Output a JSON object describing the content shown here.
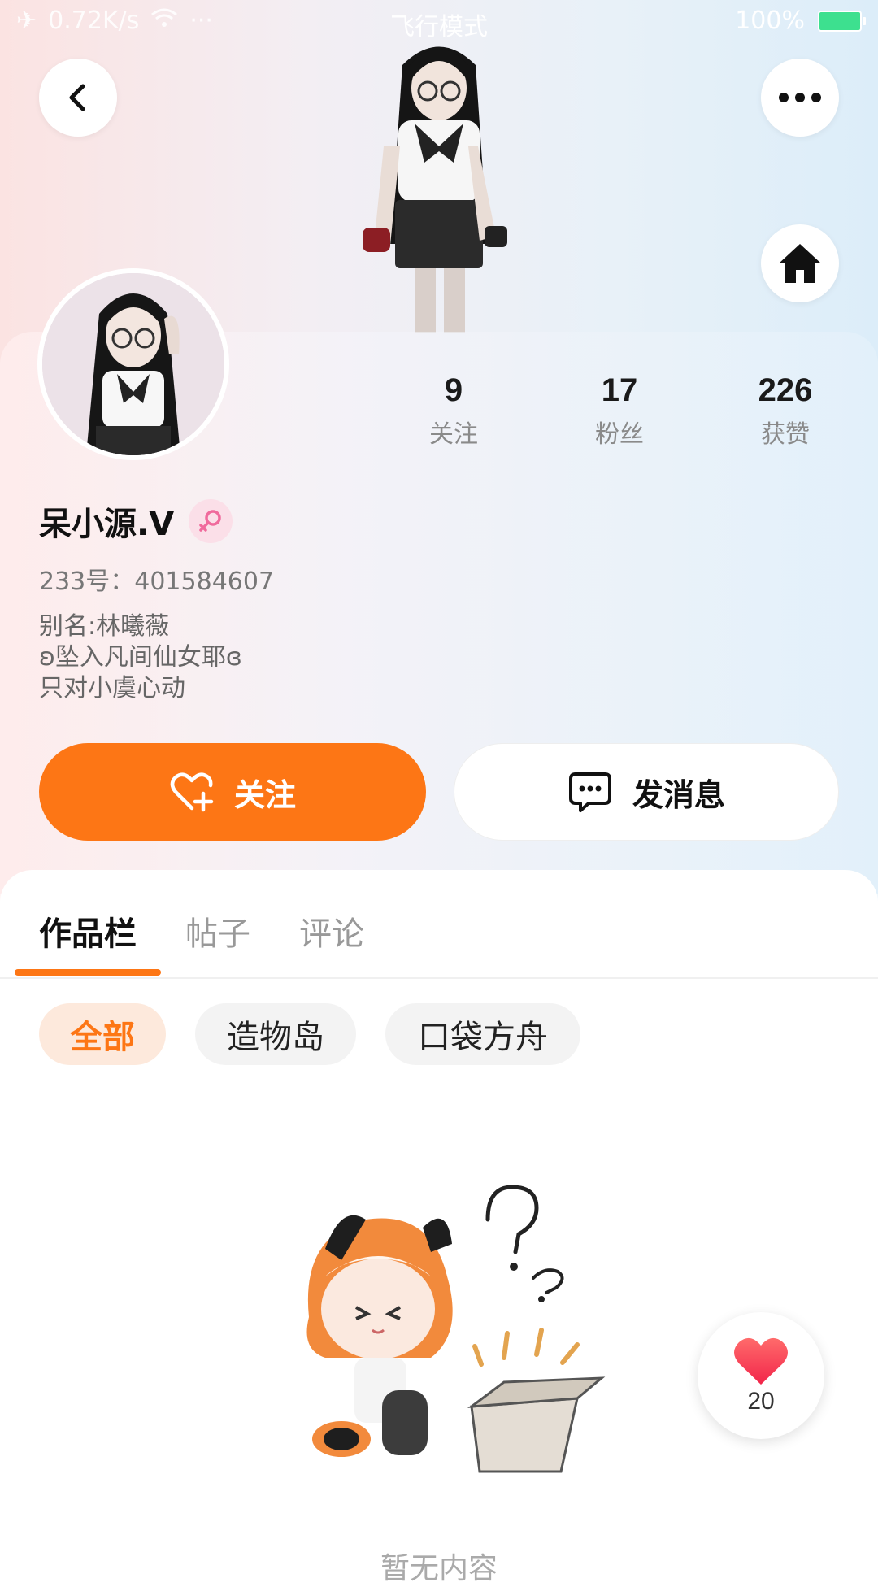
{
  "status_bar": {
    "network_speed": "0.72K/s",
    "dots": "···",
    "mode": "飞行模式",
    "battery": "100%"
  },
  "profile": {
    "name": "呆小源.V",
    "uid_text": "233号：401584607",
    "bio_lines": [
      "别名:林曦薇",
      "ʚ坠入凡间仙女耶ɞ",
      "只对小虞心动"
    ],
    "gender": "female"
  },
  "stats": [
    {
      "value": "9",
      "label": "关注"
    },
    {
      "value": "17",
      "label": "粉丝"
    },
    {
      "value": "226",
      "label": "获赞"
    }
  ],
  "actions": {
    "follow_label": "关注",
    "message_label": "发消息"
  },
  "tabs": [
    {
      "label": "作品栏",
      "active": true
    },
    {
      "label": "帖子",
      "active": false
    },
    {
      "label": "评论",
      "active": false
    }
  ],
  "filters": [
    {
      "label": "全部",
      "active": true
    },
    {
      "label": "造物岛",
      "active": false
    },
    {
      "label": "口袋方舟",
      "active": false
    }
  ],
  "empty_state": {
    "text": "暂无内容"
  },
  "like_fab": {
    "count": "20"
  },
  "colors": {
    "accent": "#fd7615",
    "female_badge": "#fbdfe8"
  }
}
